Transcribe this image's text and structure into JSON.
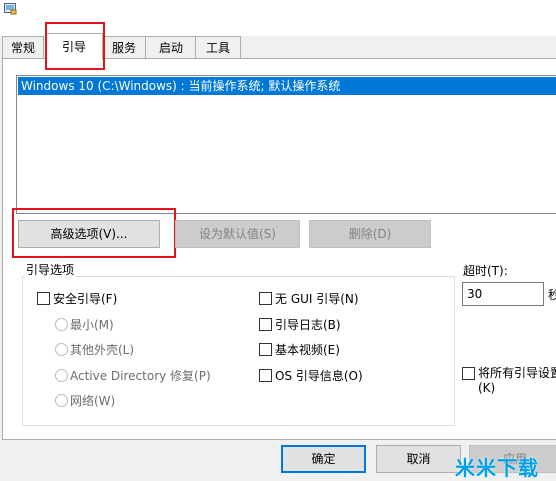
{
  "tabs": [
    {
      "label": "常规"
    },
    {
      "label": "引导"
    },
    {
      "label": "服务"
    },
    {
      "label": "启动"
    },
    {
      "label": "工具"
    }
  ],
  "boot_list": {
    "entries": [
      "Windows 10 (C:\\Windows) : 当前操作系统; 默认操作系统"
    ],
    "selected_index": 0
  },
  "buttons": {
    "advanced": "高级选项(V)...",
    "set_default": "设为默认值(S)",
    "delete": "删除(D)"
  },
  "boot_options": {
    "group_label": "引导选项",
    "safe_boot": "安全引导(F)",
    "minimal": "最小(M)",
    "alternate_shell": "其他外壳(L)",
    "active_directory": "Active Directory 修复(P)",
    "network": "网络(W)",
    "no_gui_boot": "无 GUI 引导(N)",
    "boot_log": "引导日志(B)",
    "base_video": "基本视频(E)",
    "os_boot_info": "OS 引导信息(O)"
  },
  "timeout": {
    "label": "超时(T):",
    "value": "30",
    "unit": "秒"
  },
  "make_permanent": {
    "line1": "将所有引导设置",
    "line2": "(K)"
  },
  "footer": {
    "ok": "确定",
    "cancel": "取消",
    "apply": "应用"
  },
  "watermark": "米米下载",
  "colors": {
    "selection": "#0078d7",
    "highlight_box": "#e3141b",
    "watermark": "#00a1e9"
  }
}
